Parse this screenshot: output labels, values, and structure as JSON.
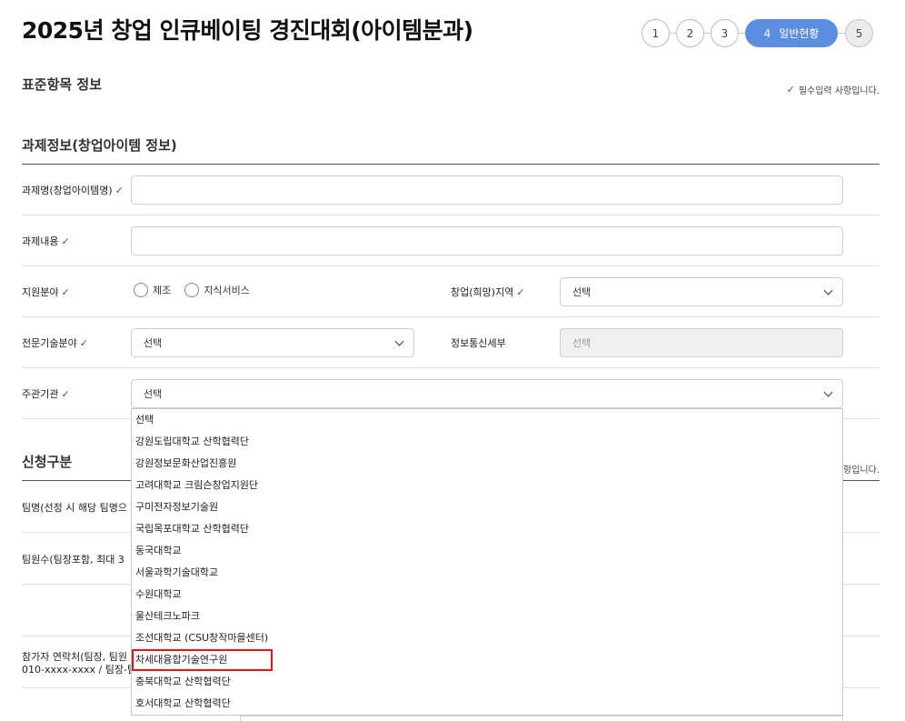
{
  "page": {
    "title": "2025년 창업 인큐베이팅 경진대회(아이템분과)"
  },
  "stepper": {
    "steps": [
      {
        "num": "1",
        "label": ""
      },
      {
        "num": "2",
        "label": ""
      },
      {
        "num": "3",
        "label": ""
      },
      {
        "num": "4",
        "label": "일반현황"
      },
      {
        "num": "5",
        "label": ""
      }
    ],
    "active_step": 4
  },
  "standard_section": {
    "title": "표준항목 정보",
    "required_note": "필수입력 사항입니다."
  },
  "project_section": {
    "title": "과제정보(창업아이템 정보)",
    "fields": {
      "project_name": {
        "label": "과제명(창업아이템명)",
        "value": ""
      },
      "project_content": {
        "label": "과제내용",
        "value": ""
      },
      "support_area": {
        "label": "지원분야",
        "options": [
          "제조",
          "지식서비스"
        ]
      },
      "region": {
        "label": "창업(희망)지역",
        "value": "선택"
      },
      "tech_field": {
        "label": "전문기술분야",
        "value": "선택"
      },
      "ict_detail": {
        "label": "정보통신세부",
        "value": "선택"
      },
      "host_org": {
        "label": "주관기관",
        "value": "선택"
      }
    }
  },
  "host_org_dropdown": {
    "options": [
      "선택",
      "강원도립대학교 산학협력단",
      "강원정보문화산업진흥원",
      "고려대학교 크림슨창업지원단",
      "구미전자정보기술원",
      "국립목포대학교 산학협력단",
      "동국대학교",
      "서울과학기술대학교",
      "수원대학교",
      "울산테크노파크",
      "조선대학교 (CSU창작마을센터)",
      "차세대융합기술연구원",
      "충북대학교 산학협력단",
      "호서대학교 산학협력단"
    ],
    "highlighted_index": 11
  },
  "apply_section": {
    "title": "신청구분",
    "required_note_tail": "항입니다.",
    "team_name_label": "팀명(선정 시 해당 팀명으",
    "team_count_label": "팀원수(팀장포함, 최대 3",
    "contact_label_1": "참가자 연락처(팀장, 팀원",
    "contact_label_2": "010-xxxx-xxxx / 팀장-팀"
  },
  "colors": {
    "accent": "#5b8ee0",
    "check": "#3a4fb0",
    "highlight_border": "#e11111"
  }
}
